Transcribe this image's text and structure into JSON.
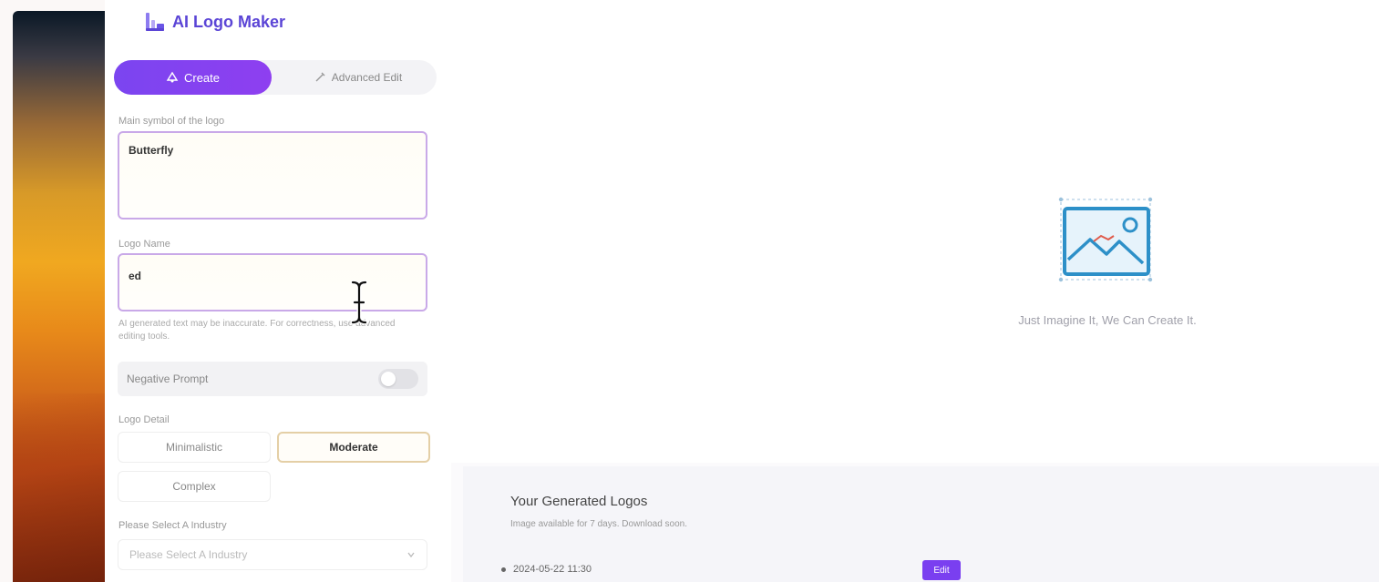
{
  "app": {
    "title": "AI Logo Maker"
  },
  "modes": {
    "create_label": "Create",
    "advanced_label": "Advanced Edit"
  },
  "form": {
    "subject_label": "Main symbol of the logo",
    "subject_value": "Butterfly",
    "name_label": "Logo Name",
    "name_value": "ed",
    "hint": "AI generated text may be inaccurate. For correctness, use advanced editing tools.",
    "negative_prompt_label": "Negative Prompt",
    "negative_prompt_enabled": false,
    "detail_label": "Logo Detail",
    "detail_options": [
      {
        "label": "Minimalistic",
        "selected": false
      },
      {
        "label": "Moderate",
        "selected": true
      },
      {
        "label": "Complex",
        "selected": false
      }
    ],
    "industry_label": "Please Select A Industry",
    "industry_placeholder": "Please Select A Industry"
  },
  "preview": {
    "empty_text": "Just Imagine It, We Can Create It."
  },
  "generated": {
    "title": "Your Generated Logos",
    "subtitle": "Image available for 7 days. Download soon.",
    "entries": [
      {
        "date": "2024-05-22 11:30",
        "badge": "Edit"
      }
    ]
  },
  "colors": {
    "accent": "#7b45f0",
    "brand_text": "#5b45d6",
    "field_border": "#c9a9e8",
    "selected_border": "#e4cfa6"
  },
  "icons": {
    "brand": "logo-maker-icon",
    "create": "create-icon",
    "advanced": "advanced-edit-icon",
    "preview": "image-placeholder-icon",
    "select": "chevron-down-icon",
    "cursor": "text-cursor-icon"
  }
}
